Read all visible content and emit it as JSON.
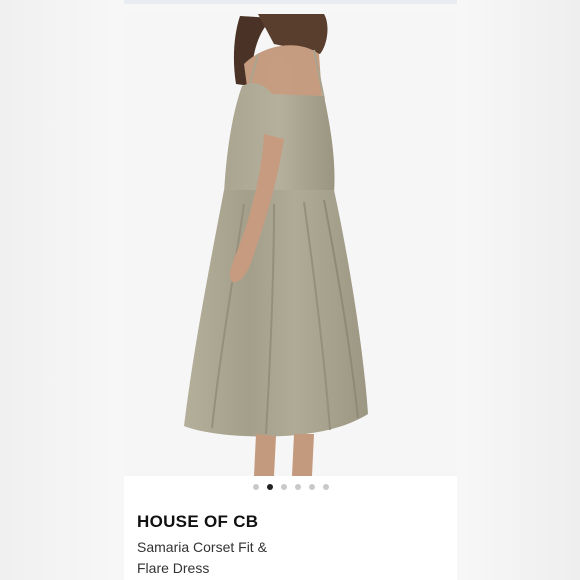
{
  "product": {
    "brand": "HOUSE OF CB",
    "title": "Samaria Corset Fit & Flare Dress"
  },
  "gallery": {
    "image_count": 6,
    "active_index": 1,
    "image_description_icon": "dress-photo"
  },
  "colors": {
    "dress": "#a8a38f",
    "background": "#f5f5f5",
    "active_dot": "#222222",
    "inactive_dot": "#c9c9c9"
  }
}
